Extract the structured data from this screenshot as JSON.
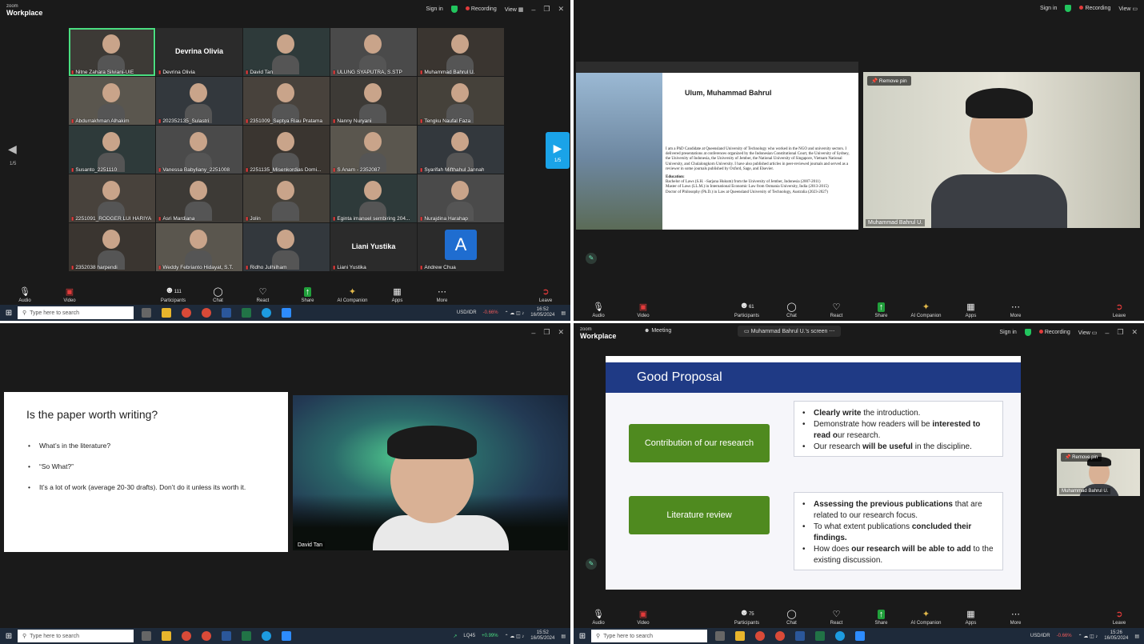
{
  "q1": {
    "logo": {
      "small": "zoom",
      "big": "Workplace"
    },
    "signin": "Sign in",
    "recording": "Recording",
    "view": "View",
    "page": "1/5",
    "page_next": "1/5",
    "tiles": [
      {
        "name": "Nitne Zahara Silviani-UIE"
      },
      {
        "name": "Devrina Olivia",
        "big": "Devrina Olivia"
      },
      {
        "name": "David Tan"
      },
      {
        "name": "ULUNG SYAPUTRA, S.STP"
      },
      {
        "name": "Muhammad Bahrul U."
      },
      {
        "name": "Abdurrakhman Alhakim"
      },
      {
        "name": "202352135_Sulastri"
      },
      {
        "name": "2351009_Septya Riau Pratama"
      },
      {
        "name": "Nanny Nuryani"
      },
      {
        "name": "Tengku Naufal Faza"
      },
      {
        "name": "Susanto_2251110"
      },
      {
        "name": "Vanessa Babyliany_2251008"
      },
      {
        "name": "2251135_Misenkordias Domi..."
      },
      {
        "name": "S Anam - 2352087"
      },
      {
        "name": "Syarifah Mifthahul Jannah"
      },
      {
        "name": "2251091_RODGER LUI HARIYA..."
      },
      {
        "name": "Asri Mardiana"
      },
      {
        "name": "Jolin"
      },
      {
        "name": "Eginta imanuel sembiring 204..."
      },
      {
        "name": "Nurajdina Harahap"
      },
      {
        "name": "2352038 harpendi"
      },
      {
        "name": "Weddy Febrianto Hidayat, S.T."
      },
      {
        "name": "Ridho Julhilham"
      },
      {
        "name": "Liani Yustika",
        "big": "Liani Yustika"
      },
      {
        "name": "Andrew Chua",
        "avatar": "A"
      }
    ],
    "toolbar": {
      "audio": "Audio",
      "video": "Video",
      "participants": "Participants",
      "participants_count": "111",
      "chat": "Chat",
      "react": "React",
      "share": "Share",
      "ai": "AI Companion",
      "apps": "Apps",
      "more": "More",
      "leave": "Leave"
    },
    "taskbar": {
      "search": "Type here to search",
      "ticker": "USD/IDR",
      "ticker_change": "-0.66%",
      "time": "16:52",
      "date": "16/05/2024"
    }
  },
  "q2": {
    "signin": "Sign in",
    "recording": "Recording",
    "view": "View",
    "shared_name": "Ulum, Muhammad Bahrul",
    "bio": "I am a PhD Candidate at Queensland University of Technology who worked in the NGO and university sectors. I delivered presentations at conferences organized by the Indonesian Constitutional Court, the University of Sydney, the University of Indonesia, the University of Jember, the National University of Singapore, Vietnam National University, and Chulalongkorn University. I have also published articles in peer-reviewed journals and served as a reviewer in some journals published by Oxford, Sage, and Elsevier.",
    "education_title": "Education:",
    "education": [
      "Bachelor of Laws (S.H. –Sarjana Hukum) from the University of Jember, Indonesia (2007-2011)",
      "Master of Laws (LL.M.) in International Economic Law from Osmania University, India (2013-2015)",
      "Doctor of Philosophy (Ph.D.) in Law at Queensland University of Technology, Australia (2023-2027)"
    ],
    "remove_pin": "Remove pin",
    "speaker_name": "Muhammad Bahrul U.",
    "toolbar": {
      "audio": "Audio",
      "video": "Video",
      "participants": "Participants",
      "participants_count": "61",
      "chat": "Chat",
      "react": "React",
      "share": "Share",
      "ai": "AI Companion",
      "apps": "Apps",
      "more": "More",
      "leave": "Leave"
    }
  },
  "q3": {
    "slide_title": "Is the paper worth writing?",
    "bullets": [
      "What’s in the literature?",
      "“So  What?”",
      "It’s a lot of work (average 20-30 drafts). Don’t do it unless its worth it."
    ],
    "speaker_name": "David Tan",
    "taskbar": {
      "search": "Type here to search",
      "ticker": "LQ45",
      "ticker_change": "+0.99%",
      "time": "15:52",
      "date": "16/05/2024"
    }
  },
  "q4": {
    "logo": {
      "small": "zoom",
      "big": "Workplace"
    },
    "meeting": "Meeting",
    "sharing_label": "Muhammad Bahrul U.'s screen",
    "signin": "Sign in",
    "recording": "Recording",
    "view": "View",
    "slide_title": "Good Proposal",
    "block1_label": "Contribution of our research",
    "block1_points": [
      [
        {
          "t": "Clearly write",
          "b": true
        },
        {
          "t": " the introduction.",
          "b": false
        }
      ],
      [
        {
          "t": "Demonstrate how readers will be ",
          "b": false
        },
        {
          "t": "interested to read o",
          "b": true
        },
        {
          "t": "ur research.",
          "b": false
        }
      ],
      [
        {
          "t": "Our research ",
          "b": false
        },
        {
          "t": "will be useful",
          "b": true
        },
        {
          "t": " in the discipline.",
          "b": false
        }
      ]
    ],
    "block2_label": "Literature review",
    "block2_points": [
      [
        {
          "t": "Assessing the previous publications",
          "b": true
        },
        {
          "t": " that are related to our research focus.",
          "b": false
        }
      ],
      [
        {
          "t": "To what extent publications ",
          "b": false
        },
        {
          "t": "concluded their findings.",
          "b": true
        }
      ],
      [
        {
          "t": "How does ",
          "b": false
        },
        {
          "t": "our research will be able to add",
          "b": true
        },
        {
          "t": " to the existing discussion.",
          "b": false
        }
      ]
    ],
    "remove_pin": "Remove pin",
    "pinned_name": "Muhammad Bahrul U.",
    "toolbar": {
      "audio": "Audio",
      "video": "Video",
      "participants": "Participants",
      "participants_count": "75",
      "chat": "Chat",
      "react": "React",
      "share": "Share",
      "ai": "AI Companion",
      "apps": "Apps",
      "more": "More",
      "leave": "Leave"
    },
    "taskbar": {
      "search": "Type here to search",
      "ticker": "USD/IDR",
      "ticker_change": "-0.66%",
      "time": "15:26",
      "date": "16/05/2024"
    }
  }
}
